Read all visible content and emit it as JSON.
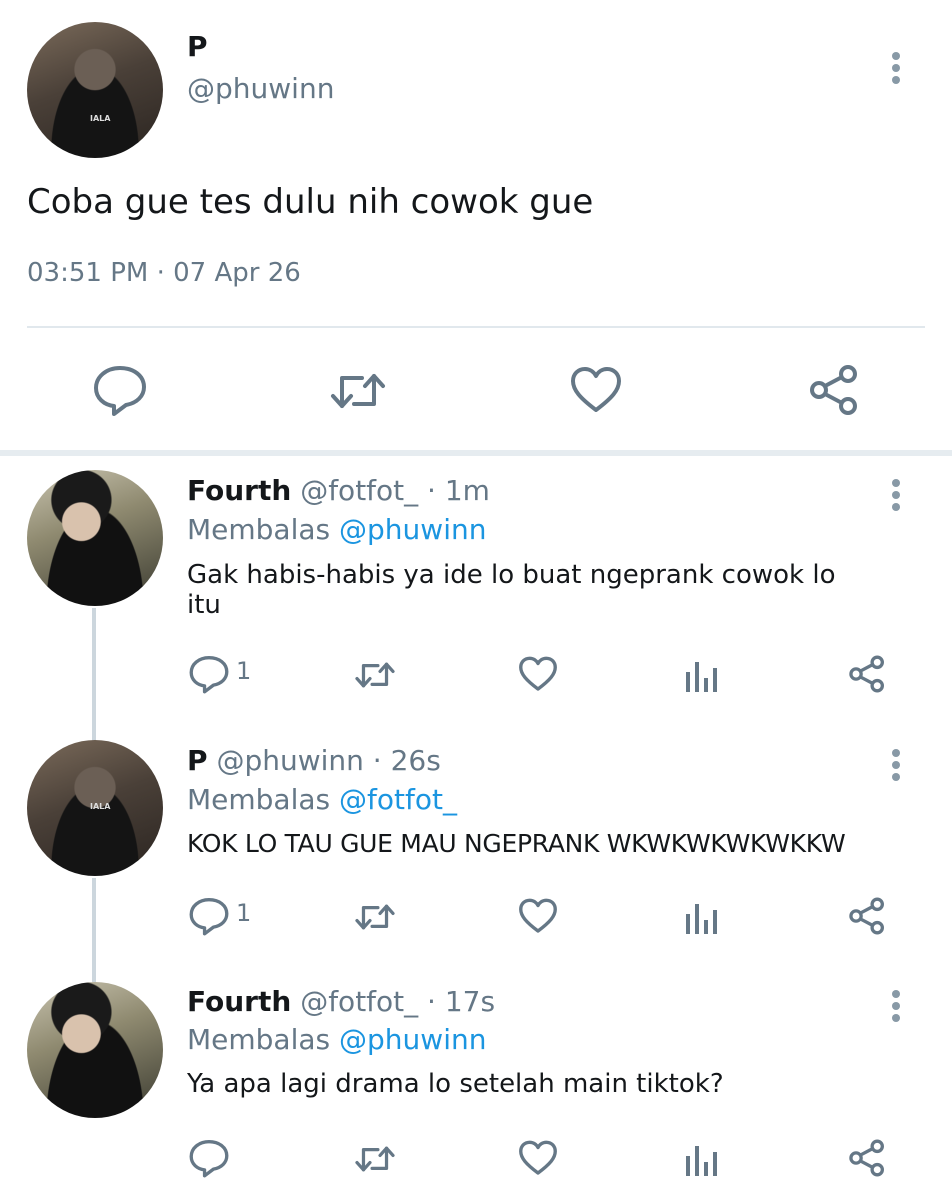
{
  "tweet": {
    "name": "P",
    "handle": "@phuwinn",
    "text": "Coba gue tes dulu nih cowok gue",
    "timestamp": "03:51 PM · 07 Apr 26"
  },
  "replies": [
    {
      "name": "Fourth",
      "handle": "@fotfot_",
      "age": "· 1m",
      "replying_prefix": "Membalas",
      "replying_to": "@phuwinn",
      "text_line1": "Gak habis-habis ya ide lo buat ngeprank cowok lo",
      "text_line2": "itu",
      "reply_count": "1"
    },
    {
      "name": "P",
      "handle": "@phuwinn",
      "age": "· 26s",
      "replying_prefix": "Membalas",
      "replying_to": "@fotfot_",
      "text_line1": "KOK LO TAU GUE MAU NGEPRANK WKWKWKWKWKKW",
      "reply_count": "1"
    },
    {
      "name": "Fourth",
      "handle": "@fotfot_",
      "age": "· 17s",
      "replying_prefix": "Membalas",
      "replying_to": "@phuwinn",
      "text_line1": "Ya apa lagi drama lo setelah main tiktok?"
    }
  ],
  "shirt_text": "IALA",
  "colors": {
    "accent": "#1b95e0",
    "icon": "#657786",
    "text": "#14171a"
  }
}
